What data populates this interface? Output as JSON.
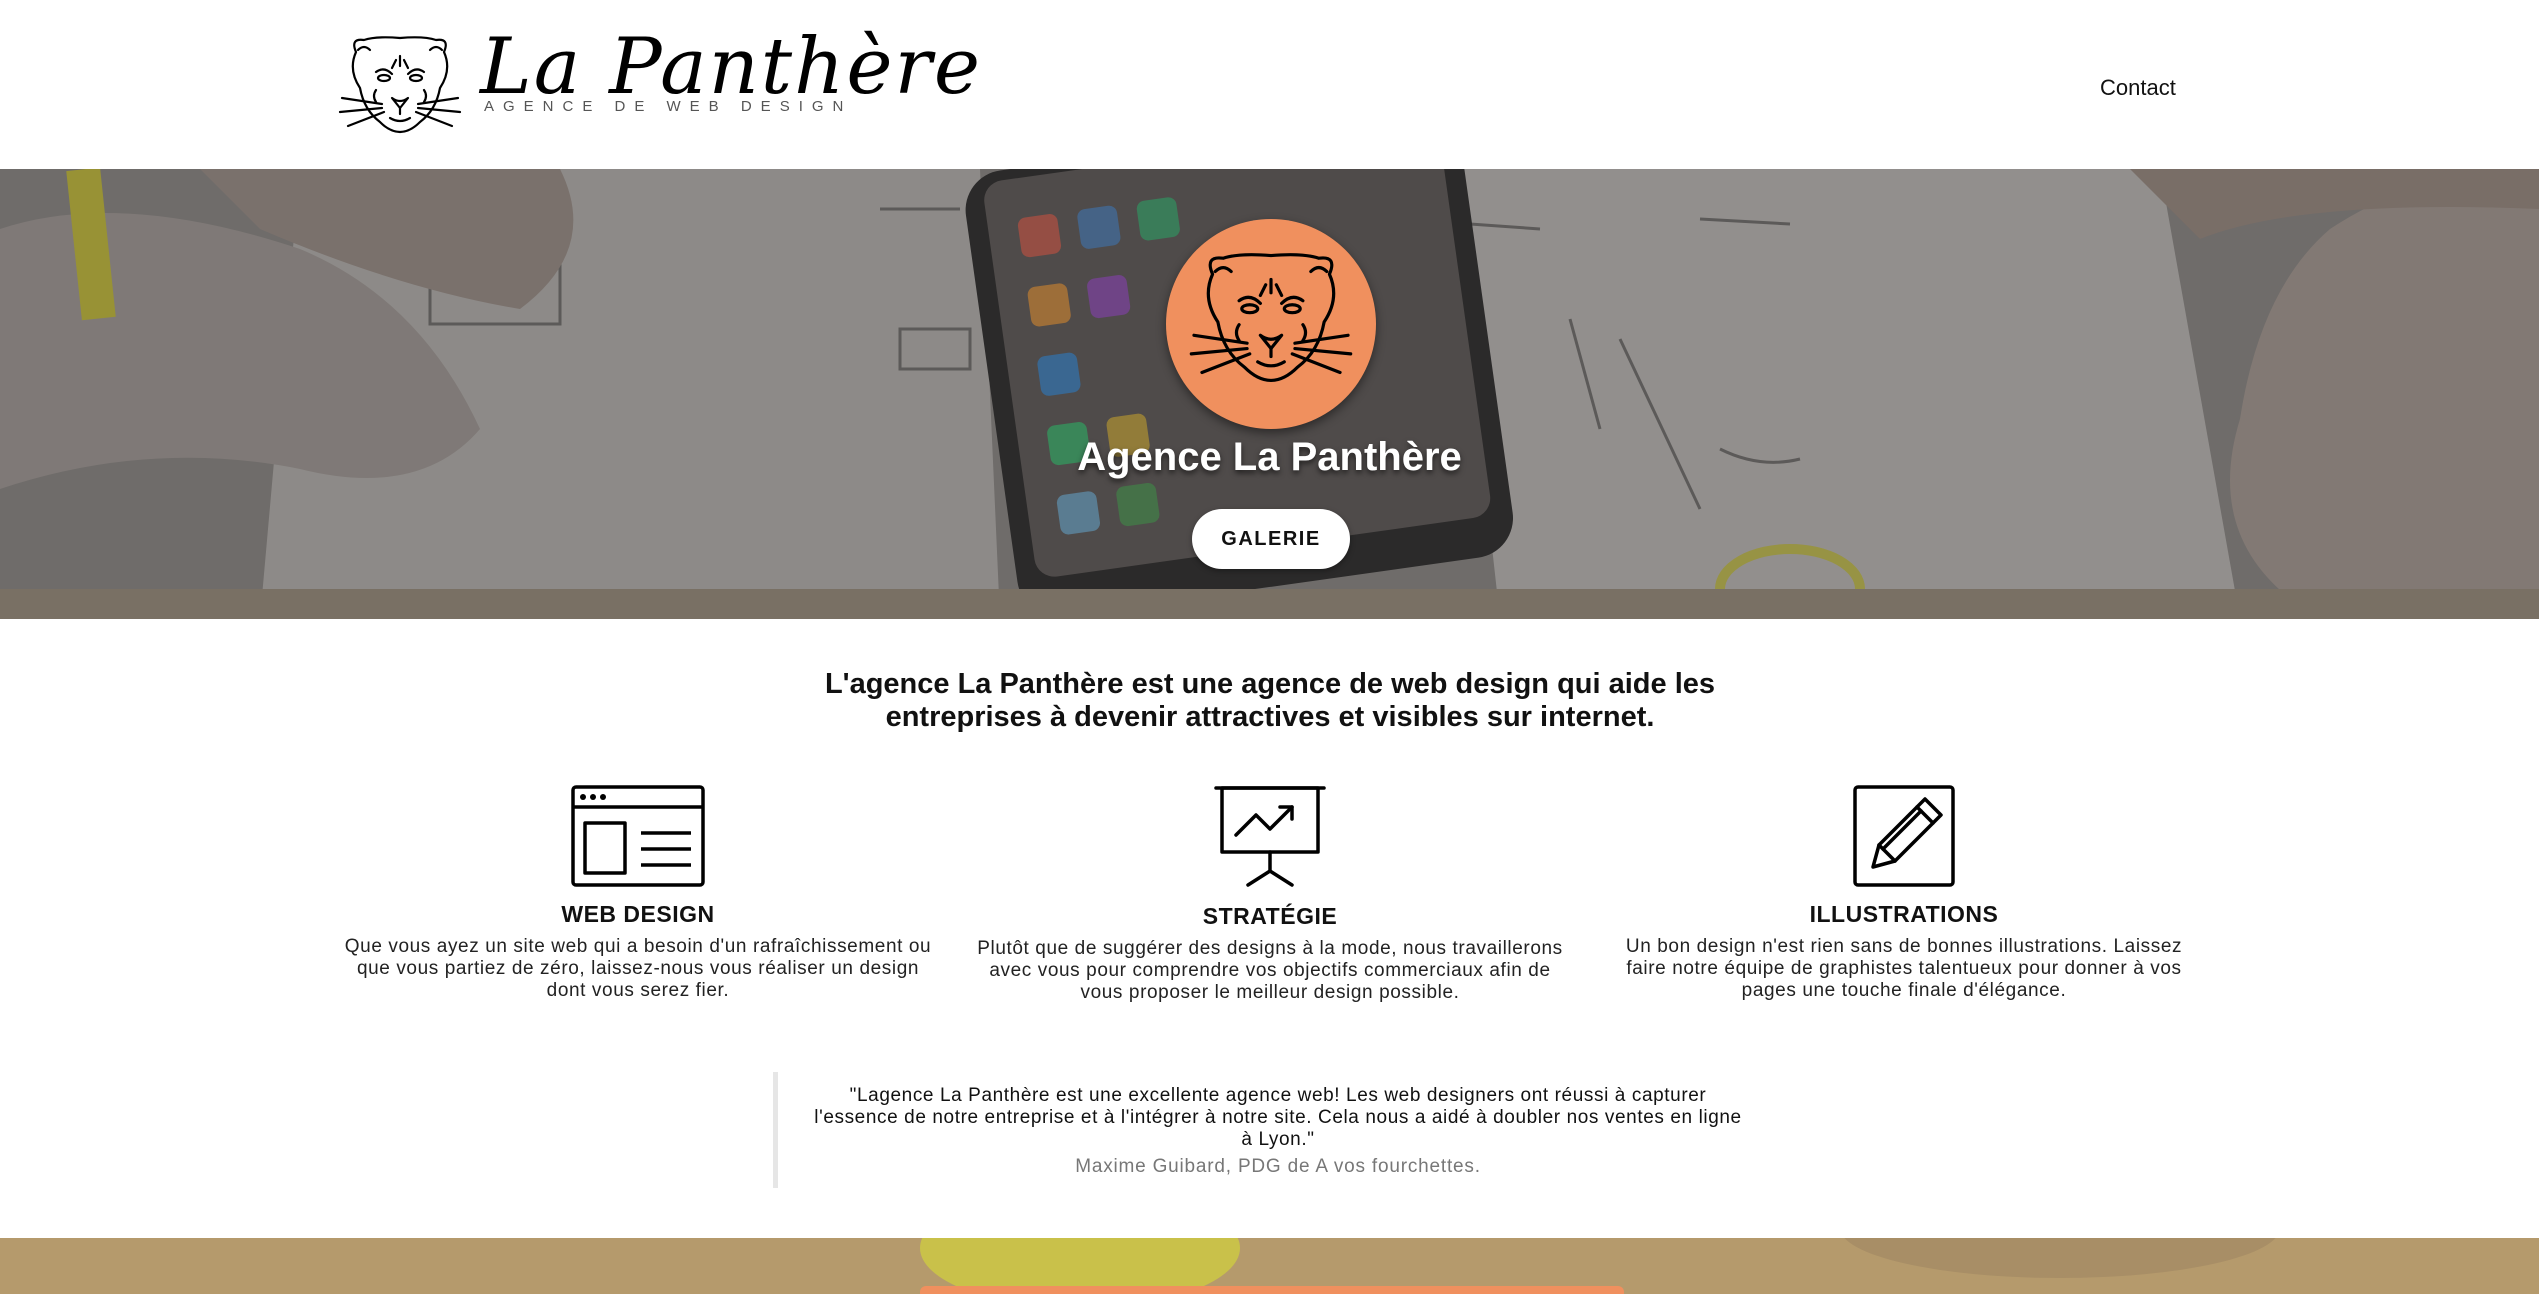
{
  "brand": {
    "name": "La Panthère",
    "tagline": "AGENCE DE WEB DESIGN"
  },
  "nav": {
    "contact": "Contact"
  },
  "hero": {
    "title": "Agence La Panthère",
    "button": "GALERIE"
  },
  "intro": {
    "text": "L'agence La Panthère est une agence de web design qui aide les entreprises à devenir attractives et visibles sur internet."
  },
  "services": [
    {
      "icon": "browser-window-icon",
      "title": "WEB DESIGN",
      "text": "Que vous ayez un site web qui a besoin d'un rafraîchissement ou que vous partiez de zéro, laissez-nous vous réaliser un design dont vous serez fier."
    },
    {
      "icon": "presentation-chart-icon",
      "title": "STRATÉGIE",
      "text": "Plutôt que de suggérer des designs à la mode, nous travaillerons avec vous pour comprendre vos objectifs commerciaux afin de vous proposer le meilleur design possible."
    },
    {
      "icon": "pencil-icon",
      "title": "ILLUSTRATIONS",
      "text": "Un bon design n'est rien sans de bonnes illustrations. Laissez faire notre équipe de graphistes talentueux pour donner à vos pages une touche finale d'élégance."
    }
  ],
  "testimonial": {
    "quote": "\"Lagence La Panthère est une excellente agence web! Les web designers ont réussi à capturer l'essence de notre entreprise et à l'intégrer à notre site. Cela nous a aidé à doubler nos ventes en ligne à Lyon.\"",
    "author": "Maxime Guibard, PDG de A vos fourchettes."
  },
  "colors": {
    "accent": "#f0905e",
    "text": "#111111",
    "muted": "#777777"
  }
}
